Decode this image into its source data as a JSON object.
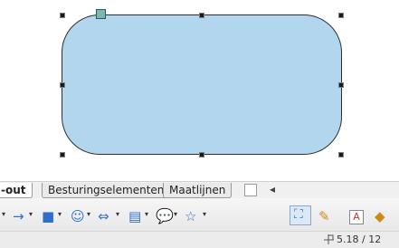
{
  "tabs": {
    "layout_partial": "-out",
    "controls": "Besturingselementen",
    "dimensions": "Maatlijnen",
    "scroll_left": "◂"
  },
  "toolbar": {
    "dropdown_glyph": "▾",
    "arrow_icon": "→",
    "rect_icon": "■",
    "smiley_icon": "☺",
    "double_arrow_icon": "⇔",
    "flowchart_icon": "▤",
    "callout_icon": "▾",
    "star_icon": "☆",
    "points_icon": "⛶",
    "pen_icon": "✎",
    "fontwork_icon": "A",
    "extra_icon": "◆",
    "colors": {
      "arrow": "#2f6fc9",
      "rect": "#2f6fc9",
      "smiley": "#2f6fc9",
      "double_arrow": "#2f6fc9",
      "flowchart": "#2f6fc9",
      "callout": "#2f6fc9",
      "star": "#2f6fc9",
      "pen": "#d08a1a",
      "fontwork": "#c0392b"
    }
  },
  "status": {
    "position": "5.18 / 12"
  },
  "shape": {
    "fill": "#b3d6ef",
    "stroke": "#2e2e2e"
  }
}
